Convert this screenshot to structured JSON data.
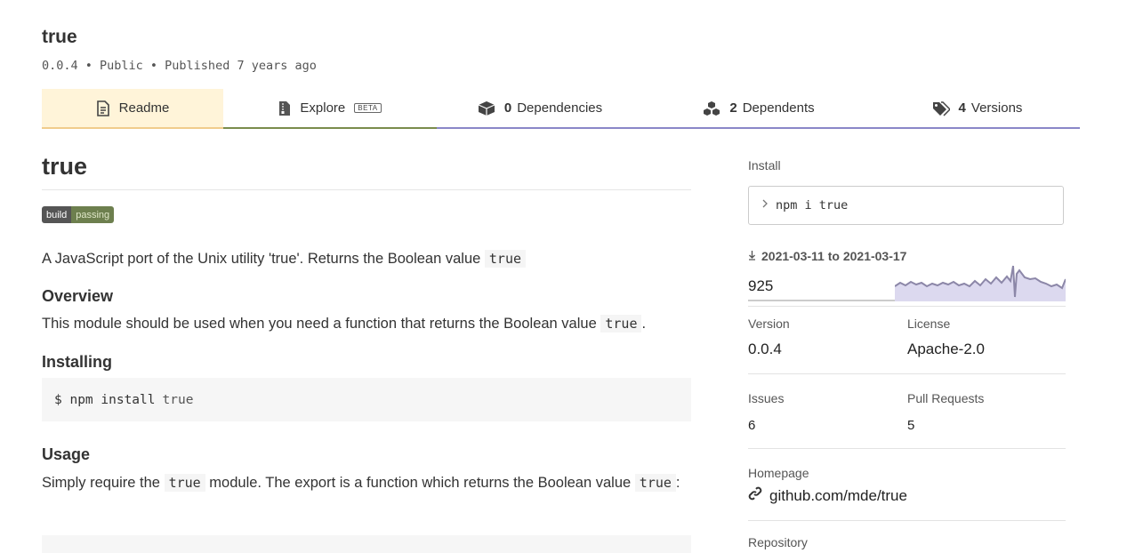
{
  "package": {
    "name": "true",
    "meta": "0.0.4 • Public • Published 7 years ago"
  },
  "tabs": {
    "readme": "Readme",
    "explore": "Explore",
    "explore_badge": "BETA",
    "dependencies_count": "0",
    "dependencies": "Dependencies",
    "dependents_count": "2",
    "dependents": "Dependents",
    "versions_count": "4",
    "versions": "Versions"
  },
  "readme": {
    "title": "true",
    "badge_left": "build",
    "badge_right": "passing",
    "intro_text": "A JavaScript port of the Unix utility 'true'. Returns the Boolean value",
    "intro_code": "true",
    "overview_heading": "Overview",
    "overview_text": "This module should be used when you need a function that returns the Boolean value",
    "overview_code": "true",
    "overview_end": ".",
    "installing_heading": "Installing",
    "install_prompt": "$ npm install",
    "install_pkg": "true",
    "usage_heading": "Usage",
    "usage_text1": "Simply require the",
    "usage_code": "true",
    "usage_text2": "module. The export is a function which returns the Boolean value",
    "usage_code2": "true",
    "usage_end": ":"
  },
  "sidebar": {
    "install_label": "Install",
    "install_cmd": "npm i true",
    "downloads_range": "2021-03-11 to 2021-03-17",
    "downloads_count": "925",
    "version_label": "Version",
    "version_value": "0.0.4",
    "license_label": "License",
    "license_value": "Apache-2.0",
    "issues_label": "Issues",
    "issues_value": "6",
    "pulls_label": "Pull Requests",
    "pulls_value": "5",
    "homepage_label": "Homepage",
    "homepage_value": "github.com/mde/true",
    "repository_label": "Repository"
  },
  "icons": {
    "readme": "document-icon",
    "explore": "file-zip-icon",
    "dependencies": "box-icon",
    "dependents": "boxes-icon",
    "versions": "tags-icon",
    "install_prompt": "chevron-right-icon",
    "downloads": "download-arrow-icon",
    "homepage": "link-icon"
  },
  "colors": {
    "readme_tab_bg": "#fff4d9",
    "readme_tab_bar": "#f0cc8c",
    "explore_tab_bar": "#7a8c4c",
    "other_tab_bar": "#8a87c8",
    "sparkline_fill": "#d9d6ee",
    "sparkline_stroke": "#8c87a8"
  }
}
